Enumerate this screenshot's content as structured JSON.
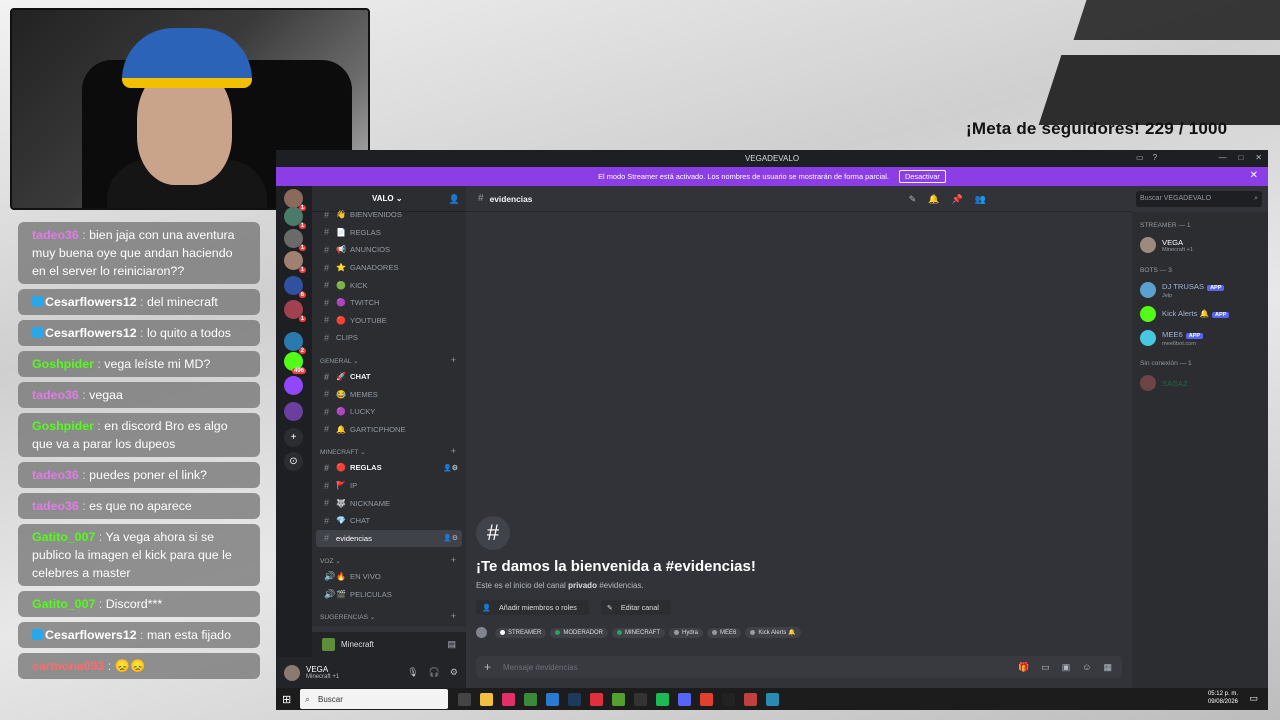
{
  "overlay": {
    "goal_text": "¡Meta de seguidores! 229 / 1000"
  },
  "stream_chat": [
    {
      "user": "tadeo36",
      "color": "#e07be8",
      "text": "bien jaja con una aventura muy buena oye que andan haciendo en el server lo reiniciaron??",
      "badge": false
    },
    {
      "user": "Cesarflowers12",
      "color": "#ffffff",
      "text": "del minecraft",
      "badge": true
    },
    {
      "user": "Cesarflowers12",
      "color": "#ffffff",
      "text": "lo quito a todos",
      "badge": true
    },
    {
      "user": "Goshpider",
      "color": "#53fc18",
      "text": "vega leíste mi MD?",
      "badge": false
    },
    {
      "user": "tadeo36",
      "color": "#e07be8",
      "text": "vegaa",
      "badge": false
    },
    {
      "user": "Goshpider",
      "color": "#53fc18",
      "text": "en discord Bro es algo que va a parar los dupeos",
      "badge": false
    },
    {
      "user": "tadeo36",
      "color": "#e07be8",
      "text": "puedes poner el link?",
      "badge": false
    },
    {
      "user": "tadeo36",
      "color": "#e07be8",
      "text": "es que no aparece",
      "badge": false
    },
    {
      "user": "Gatito_007",
      "color": "#53fc18",
      "text": "Ya vega ahora si se publico la imagen el kick para que le celebres a master",
      "badge": false
    },
    {
      "user": "Gatito_007",
      "color": "#53fc18",
      "text": "Discord***",
      "badge": false
    },
    {
      "user": "Cesarflowers12",
      "color": "#ffffff",
      "text": "man esta fijado",
      "badge": true
    },
    {
      "user": "carmona093",
      "color": "#ff6b6b",
      "text": "😞😞",
      "badge": false
    }
  ],
  "discord": {
    "window_title": "VEGADEVALO",
    "banner_text": "El modo Streamer está activado. Los nombres de usuario se mostrarán de forma parcial.",
    "banner_button": "Desactivar",
    "server_name": "VALO",
    "categories": {
      "general": "GENERAL",
      "minecraft": "MINECRAFT",
      "voz": "VOZ",
      "sugerencias": "SUGERENCIAS"
    },
    "channels_top": [
      {
        "label": "BIENVENIDOS",
        "emoji": "👋"
      },
      {
        "label": "REGLAS",
        "emoji": "📄"
      },
      {
        "label": "ANUNCIOS",
        "emoji": "📢"
      },
      {
        "label": "GANADORES",
        "emoji": "⭐"
      },
      {
        "label": "KICK",
        "emoji": "🟢"
      },
      {
        "label": "TWITCH",
        "emoji": "🟣"
      },
      {
        "label": "YOUTUBE",
        "emoji": "🔴"
      },
      {
        "label": "CLIPS",
        "emoji": ""
      }
    ],
    "channels_general": [
      {
        "label": "CHAT",
        "emoji": "🚀"
      },
      {
        "label": "MEMES",
        "emoji": "😂"
      },
      {
        "label": "LUCKY",
        "emoji": "🟣"
      },
      {
        "label": "GARTICPHONE",
        "emoji": "🔔"
      }
    ],
    "channels_minecraft": [
      {
        "label": "REGLAS",
        "emoji": "🔴"
      },
      {
        "label": "IP",
        "emoji": "🚩"
      },
      {
        "label": "NICKNAME",
        "emoji": "🐺"
      },
      {
        "label": "CHAT",
        "emoji": "💎"
      },
      {
        "label": "evidencias",
        "emoji": ""
      }
    ],
    "channels_voz": [
      {
        "label": "EN VIVO",
        "emoji": "🔥"
      },
      {
        "label": "PELICULAS",
        "emoji": "🎬"
      }
    ],
    "voice_status": "Minecraft",
    "user": {
      "name": "VEGA",
      "status": "Minecraft +1"
    },
    "current_channel": "evidencias",
    "search_placeholder": "Buscar VEGADEVALO",
    "welcome_title": "¡Te damos la bienvenida a #evidencias!",
    "welcome_pre": "Este es el inicio del canal",
    "welcome_bold": "privado",
    "welcome_post": "#evidencias.",
    "action_add": "Añadir miembros o roles",
    "action_edit": "Editar canal",
    "roles": [
      {
        "label": "STREAMER",
        "color": "#ffffff"
      },
      {
        "label": "MODERADOR",
        "color": "#23a55a"
      },
      {
        "label": "MINECRAFT",
        "color": "#23a55a"
      },
      {
        "label": "Hydra",
        "color": "#949ba4"
      },
      {
        "label": "MEE6",
        "color": "#949ba4"
      },
      {
        "label": "Kick Alerts 🔔",
        "color": "#949ba4"
      }
    ],
    "composer_placeholder": "Mensaje #evidencias",
    "members": {
      "streamer_header": "STREAMER — 1",
      "bots_header": "BOTS — 3",
      "offline_header": "Sin conexión — 1",
      "streamer": {
        "name": "VEGA",
        "status": "Minecraft +1"
      },
      "bots": [
        {
          "name": "DJ TRUSAS",
          "status": "Jelp",
          "tag": "APP"
        },
        {
          "name": "Kick Alerts 🔔",
          "status": "",
          "tag": "APP"
        },
        {
          "name": "MEE6",
          "status": "mee6bot.com",
          "tag": "APP"
        }
      ],
      "offline": {
        "name": "SAGAZ"
      }
    },
    "server_badges": [
      "1",
      "1",
      "1",
      "1",
      "6",
      "1",
      "2",
      "496"
    ]
  },
  "taskbar": {
    "search_placeholder": "Buscar",
    "time": "05:12 p. m.",
    "date": "09/08/2026"
  }
}
